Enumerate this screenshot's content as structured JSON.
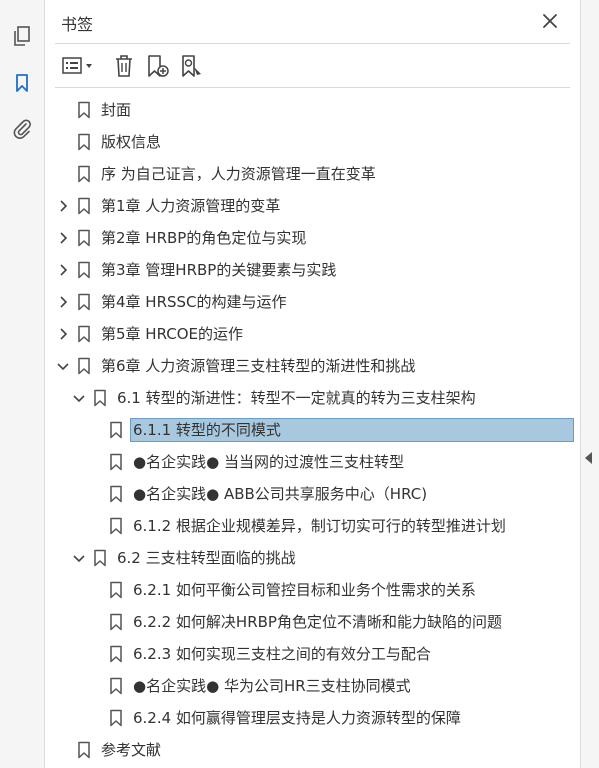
{
  "panel": {
    "title": "书签"
  },
  "toolbar": {
    "options_icon": "list-options-icon",
    "delete_icon": "trash-icon",
    "new_bookmark_icon": "bookmark-add-icon",
    "bookmark_search_icon": "bookmark-search-icon"
  },
  "bookmarks": [
    {
      "label": "封面"
    },
    {
      "label": "版权信息"
    },
    {
      "label": "序 为自己证言，人力资源管理一直在变革"
    },
    {
      "label": "第1章 人力资源管理的变革"
    },
    {
      "label": "第2章 HRBP的角色定位与实现"
    },
    {
      "label": "第3章 管理HRBP的关键要素与实践"
    },
    {
      "label": "第4章 HRSSC的构建与运作"
    },
    {
      "label": "第5章 HRCOE的运作"
    },
    {
      "label": "第6章 人力资源管理三支柱转型的渐进性和挑战"
    },
    {
      "label": "6.1 转型的渐进性：转型不一定就真的转为三支柱架构"
    },
    {
      "label": "6.1.1 转型的不同模式"
    },
    {
      "label": "●名企实践● 当当网的过渡性三支柱转型"
    },
    {
      "label": "●名企实践● ABB公司共享服务中心（HRC)"
    },
    {
      "label": "6.1.2 根据企业规模差异，制订切实可行的转型推进计划"
    },
    {
      "label": "6.2 三支柱转型面临的挑战"
    },
    {
      "label": "6.2.1 如何平衡公司管控目标和业务个性需求的关系"
    },
    {
      "label": "6.2.2 如何解决HRBP角色定位不清晰和能力缺陷的问题"
    },
    {
      "label": "6.2.3 如何实现三支柱之间的有效分工与配合"
    },
    {
      "label": "●名企实践● 华为公司HR三支柱协同模式"
    },
    {
      "label": "6.2.4 如何赢得管理层支持是人力资源转型的保障"
    },
    {
      "label": "参考文献"
    }
  ],
  "colors": {
    "selected_bg": "#a8c8e0",
    "accent": "#1f6fc5"
  }
}
